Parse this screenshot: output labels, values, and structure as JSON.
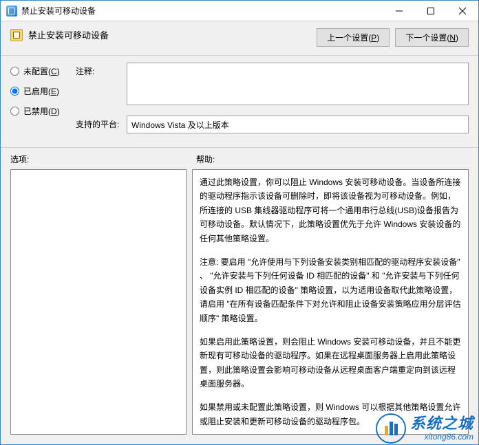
{
  "window": {
    "title": "禁止安装可移动设备"
  },
  "header": {
    "policy_title": "禁止安装可移动设备",
    "prev_btn": "上一个设置",
    "prev_key": "P",
    "next_btn": "下一个设置",
    "next_key": "N"
  },
  "state": {
    "not_configured_label": "未配置",
    "not_configured_key": "C",
    "enabled_label": "已启用",
    "enabled_key": "E",
    "disabled_label": "已禁用",
    "disabled_key": "D",
    "selected": "enabled"
  },
  "fields": {
    "comment_label": "注释:",
    "comment_value": "",
    "platform_label": "支持的平台:",
    "platform_value": "Windows Vista 及以上版本"
  },
  "panes": {
    "options_label": "选项:",
    "help_label": "帮助:",
    "help_paragraphs": [
      "通过此策略设置，你可以阻止 Windows 安装可移动设备。当设备所连接的驱动程序指示该设备可删除时，即将该设备视为可移动设备。例如，所连接的 USB 集线器驱动程序可将一个通用串行总线(USB)设备报告为可移动设备。默认情况下，此策略设置优先于允许 Windows 安装设备的任何其他策略设置。",
      "注意: 要启用 \"允许使用与下列设备安装类别相匹配的驱动程序安装设备\" 、 \"允许安装与下列任何设备 ID 相匹配的设备\" 和 \"允许安装与下列任何设备实例 ID 相匹配的设备\" 策略设置，以为适用设备取代此策略设置，请启用 \"在所有设备匹配条件下对允许和阻止设备安装策略应用分层评估顺序\" 策略设置。",
      "如果启用此策略设置，则会阻止 Windows 安装可移动设备，并且不能更新现有可移动设备的驱动程序。如果在远程桌面服务器上启用此策略设置，则此策略设置会影响可移动设备从远程桌面客户端重定向到该远程桌面服务器。",
      "如果禁用或未配置此策略设置，则 Windows 可以根据其他策略设置允许或阻止安装和更新可移动设备的驱动程序包。"
    ]
  },
  "watermark": {
    "main": "系统之城",
    "sub": "xitong86.com"
  }
}
